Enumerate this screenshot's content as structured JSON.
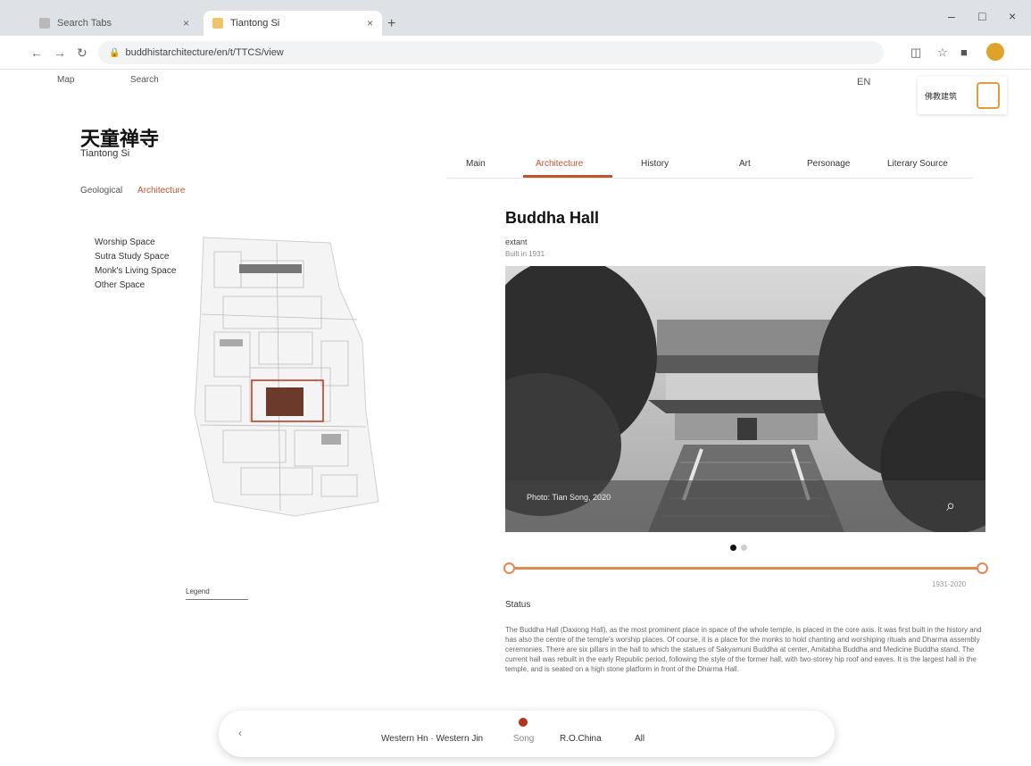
{
  "browser": {
    "tabs": [
      {
        "label": "Search Tabs",
        "active": false
      },
      {
        "label": "Tiantong Si",
        "active": true
      }
    ],
    "url": "buddhistarchitecture/en/t/TTCS/view"
  },
  "site": {
    "top_nav": [
      "Map",
      "Search"
    ],
    "lang": "EN",
    "logo_text": "佛教建筑",
    "title_cn": "天童禅寺",
    "title_en": "Tiantong Si"
  },
  "main_nav": {
    "items": [
      "Main",
      "Architecture",
      "History",
      "Art",
      "Personage",
      "Literary Source"
    ],
    "active_index": 1
  },
  "sub_nav": {
    "items": [
      "Geological",
      "Architecture"
    ],
    "active_index": 1
  },
  "plan": {
    "legend": [
      "Worship Space",
      "Sutra Study Space",
      "Monk's Living Space",
      "Other Space"
    ],
    "zoom_label": "Legend"
  },
  "detail": {
    "title": "Buddha Hall",
    "meta1": "extant",
    "meta2": "Built in 1931",
    "photo_caption": "Photo: Tian Song, 2020",
    "carousel": {
      "count": 2,
      "active": 0
    },
    "timeline_label": "1931-2020",
    "status_heading": "Status",
    "body": "The Buddha Hall (Daxiong Hall), as the most prominent place in space of the whole temple, is placed in the core axis. It was first built in the history and has also the centre of the temple's worship places. Of course, it is a place for the monks to hold chanting and worshiping rituals and Dharma assembly ceremonies. There are six pillars in the hall to which the statues of Sakyamuni Buddha at center, Amitabha Buddha and Medicine Buddha stand. The current hall was rebuilt in the early Republic period, following the style of the former hall, with two-storey hip roof and eaves. It is the largest hall in the temple, and is seated on a high stone platform in front of the Dharma Hall."
  },
  "float_bar": {
    "items": [
      "Western Hn · Western Jin",
      "Song",
      "R.O.China",
      "All"
    ],
    "active_index": 1
  },
  "colors": {
    "accent": "#c0532e",
    "timeline": "#e08a52",
    "marker": "#b3341b"
  }
}
